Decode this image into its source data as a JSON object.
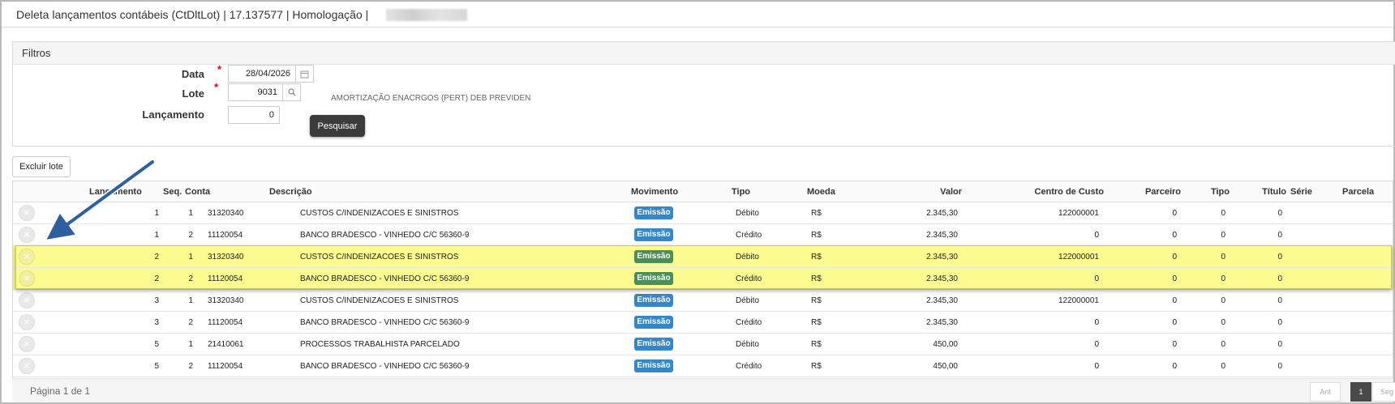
{
  "window": {
    "title": "Deleta lançamentos contábeis (CtDltLot) | 17.137577 | Homologação |"
  },
  "filters": {
    "panel_title": "Filtros",
    "date_label": "Data",
    "date_value": "28/04/2026",
    "lote_label": "Lote",
    "lote_value": "9031",
    "lote_description": "AMORTIZAÇÃO ENACRGOS (PERT) DEB PREVIDEN",
    "lancamento_label": "Lançamento",
    "lancamento_value": "0",
    "required_marker": "*",
    "search_button": "Pesquisar"
  },
  "actions": {
    "delete_batch": "Excluir lote"
  },
  "table": {
    "columns": [
      "Lançamento",
      "Seq.",
      "Conta",
      "Descrição",
      "Movimento",
      "Tipo",
      "Moeda",
      "Valor",
      "Centro de Custo",
      "Parceiro",
      "Tipo",
      "Título",
      "Série",
      "Parcela"
    ],
    "rows": [
      {
        "lancamento": "1",
        "seq": "1",
        "conta": "31320340",
        "descricao": "CUSTOS C/INDENIZACOES E SINISTROS",
        "movimento": "Emissão",
        "tipo": "Débito",
        "moeda": "R$",
        "valor": "2.345,30",
        "centro_custo": "122000001",
        "parceiro": "0",
        "tipo2": "0",
        "titulo": "0",
        "highlighted": false
      },
      {
        "lancamento": "1",
        "seq": "2",
        "conta": "11120054",
        "descricao": "BANCO BRADESCO - VINHEDO C/C 56360-9",
        "movimento": "Emissão",
        "tipo": "Crédito",
        "moeda": "R$",
        "valor": "2.345,30",
        "centro_custo": "0",
        "parceiro": "0",
        "tipo2": "0",
        "titulo": "0",
        "highlighted": false
      },
      {
        "lancamento": "2",
        "seq": "1",
        "conta": "31320340",
        "descricao": "CUSTOS C/INDENIZACOES E SINISTROS",
        "movimento": "Emissão",
        "tipo": "Débito",
        "moeda": "R$",
        "valor": "2.345,30",
        "centro_custo": "122000001",
        "parceiro": "0",
        "tipo2": "0",
        "titulo": "0",
        "highlighted": true
      },
      {
        "lancamento": "2",
        "seq": "2",
        "conta": "11120054",
        "descricao": "BANCO BRADESCO - VINHEDO C/C 56360-9",
        "movimento": "Emissão",
        "tipo": "Crédito",
        "moeda": "R$",
        "valor": "2.345,30",
        "centro_custo": "0",
        "parceiro": "0",
        "tipo2": "0",
        "titulo": "0",
        "highlighted": true
      },
      {
        "lancamento": "3",
        "seq": "1",
        "conta": "31320340",
        "descricao": "CUSTOS C/INDENIZACOES E SINISTROS",
        "movimento": "Emissão",
        "tipo": "Débito",
        "moeda": "R$",
        "valor": "2.345,30",
        "centro_custo": "122000001",
        "parceiro": "0",
        "tipo2": "0",
        "titulo": "0",
        "highlighted": false
      },
      {
        "lancamento": "3",
        "seq": "2",
        "conta": "11120054",
        "descricao": "BANCO BRADESCO - VINHEDO C/C 56360-9",
        "movimento": "Emissão",
        "tipo": "Crédito",
        "moeda": "R$",
        "valor": "2.345,30",
        "centro_custo": "0",
        "parceiro": "0",
        "tipo2": "0",
        "titulo": "0",
        "highlighted": false
      },
      {
        "lancamento": "5",
        "seq": "1",
        "conta": "21410061",
        "descricao": "PROCESSOS TRABALHISTA PARCELADO",
        "movimento": "Emissão",
        "tipo": "Débito",
        "moeda": "R$",
        "valor": "450,00",
        "centro_custo": "0",
        "parceiro": "0",
        "tipo2": "0",
        "titulo": "0",
        "highlighted": false
      },
      {
        "lancamento": "5",
        "seq": "2",
        "conta": "11120054",
        "descricao": "BANCO BRADESCO - VINHEDO C/C 56360-9",
        "movimento": "Emissão",
        "tipo": "Crédito",
        "moeda": "R$",
        "valor": "450,00",
        "centro_custo": "0",
        "parceiro": "0",
        "tipo2": "0",
        "titulo": "0",
        "highlighted": false
      }
    ]
  },
  "footer": {
    "page_info": "Página 1 de 1",
    "prev": "Ant",
    "current": "1",
    "next": "Seg"
  },
  "icons": {
    "calendar": "calendar-icon",
    "search": "search-icon",
    "delete": "close-circle-icon"
  },
  "colors": {
    "highlight": "#fbfb8f",
    "badge_blue": "#3488c9",
    "badge_green": "#4a8e58",
    "arrow": "#2e5f9e"
  }
}
